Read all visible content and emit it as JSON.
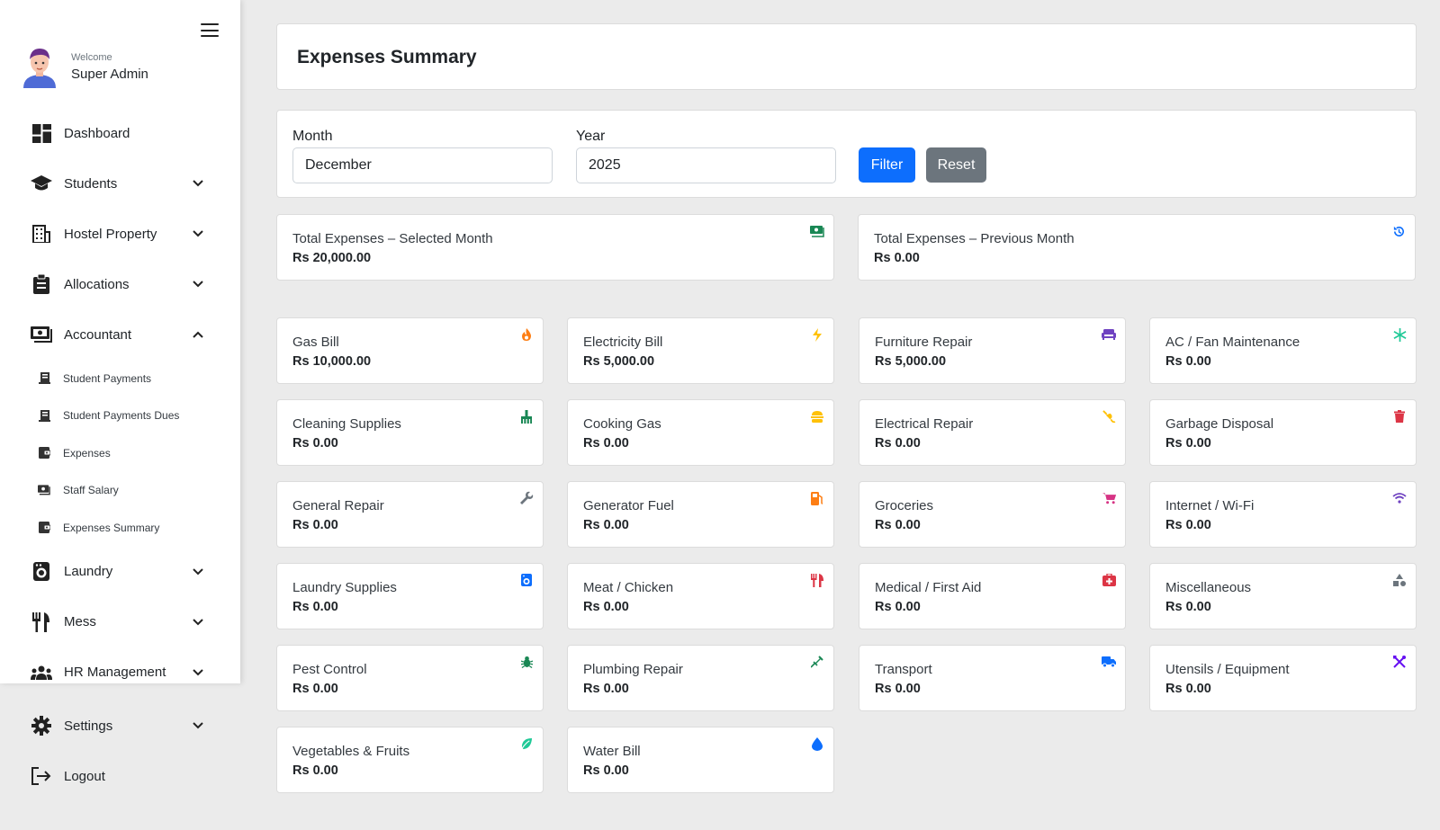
{
  "sidebar": {
    "welcome": "Welcome",
    "user_name": "Super Admin",
    "items": [
      {
        "label": "Dashboard"
      },
      {
        "label": "Students"
      },
      {
        "label": "Hostel Property"
      },
      {
        "label": "Allocations"
      },
      {
        "label": "Accountant"
      },
      {
        "label": "Laundry"
      },
      {
        "label": "Mess"
      },
      {
        "label": "HR Management"
      },
      {
        "label": "Settings"
      },
      {
        "label": "Logout"
      }
    ],
    "accountant_sub": [
      {
        "label": "Student Payments"
      },
      {
        "label": "Student Payments Dues"
      },
      {
        "label": "Expenses"
      },
      {
        "label": "Staff Salary"
      },
      {
        "label": "Expenses Summary"
      }
    ]
  },
  "page": {
    "title": "Expenses Summary"
  },
  "filter": {
    "month_label": "Month",
    "month_value": "December",
    "year_label": "Year",
    "year_value": "2025",
    "filter_button": "Filter",
    "reset_button": "Reset"
  },
  "totals": [
    {
      "title": "Total Expenses – Selected Month",
      "value": "Rs 20,000.00",
      "icon": "money-icon",
      "color": "#198754"
    },
    {
      "title": "Total Expenses – Previous Month",
      "value": "Rs 0.00",
      "icon": "history-icon",
      "color": "#0d6efd"
    }
  ],
  "categories": [
    {
      "title": "Gas Bill",
      "value": "Rs 10,000.00",
      "icon": "fire-icon",
      "color": "#fd7e14"
    },
    {
      "title": "Electricity Bill",
      "value": "Rs 5,000.00",
      "icon": "bolt-icon",
      "color": "#ffc107"
    },
    {
      "title": "Furniture Repair",
      "value": "Rs 5,000.00",
      "icon": "couch-icon",
      "color": "#6f42c1"
    },
    {
      "title": "AC / Fan Maintenance",
      "value": "Rs 0.00",
      "icon": "snowflake-icon",
      "color": "#20c997"
    },
    {
      "title": "Cleaning Supplies",
      "value": "Rs 0.00",
      "icon": "broom-icon",
      "color": "#198754"
    },
    {
      "title": "Cooking Gas",
      "value": "Rs 0.00",
      "icon": "burger-icon",
      "color": "#ffc107"
    },
    {
      "title": "Electrical Repair",
      "value": "Rs 0.00",
      "icon": "plug-icon",
      "color": "#ffc107"
    },
    {
      "title": "Garbage Disposal",
      "value": "Rs 0.00",
      "icon": "trash-icon",
      "color": "#dc3545"
    },
    {
      "title": "General Repair",
      "value": "Rs 0.00",
      "icon": "wrench-icon",
      "color": "#6c757d"
    },
    {
      "title": "Generator Fuel",
      "value": "Rs 0.00",
      "icon": "gas-pump-icon",
      "color": "#fd7e14"
    },
    {
      "title": "Groceries",
      "value": "Rs 0.00",
      "icon": "cart-icon",
      "color": "#d63384"
    },
    {
      "title": "Internet / Wi-Fi",
      "value": "Rs 0.00",
      "icon": "wifi-icon",
      "color": "#6f42c1"
    },
    {
      "title": "Laundry Supplies",
      "value": "Rs 0.00",
      "icon": "washer-icon",
      "color": "#0d6efd"
    },
    {
      "title": "Meat / Chicken",
      "value": "Rs 0.00",
      "icon": "utensils-icon",
      "color": "#dc3545"
    },
    {
      "title": "Medical / First Aid",
      "value": "Rs 0.00",
      "icon": "first-aid-icon",
      "color": "#dc3545"
    },
    {
      "title": "Miscellaneous",
      "value": "Rs 0.00",
      "icon": "shapes-icon",
      "color": "#6c757d"
    },
    {
      "title": "Pest Control",
      "value": "Rs 0.00",
      "icon": "bug-icon",
      "color": "#198754"
    },
    {
      "title": "Plumbing Repair",
      "value": "Rs 0.00",
      "icon": "syringe-icon",
      "color": "#198754"
    },
    {
      "title": "Transport",
      "value": "Rs 0.00",
      "icon": "truck-icon",
      "color": "#0d6efd"
    },
    {
      "title": "Utensils / Equipment",
      "value": "Rs 0.00",
      "icon": "tools-icon",
      "color": "#6610f2"
    },
    {
      "title": "Vegetables & Fruits",
      "value": "Rs 0.00",
      "icon": "leaf-icon",
      "color": "#20c997"
    },
    {
      "title": "Water Bill",
      "value": "Rs 0.00",
      "icon": "droplet-icon",
      "color": "#0d6efd"
    }
  ]
}
